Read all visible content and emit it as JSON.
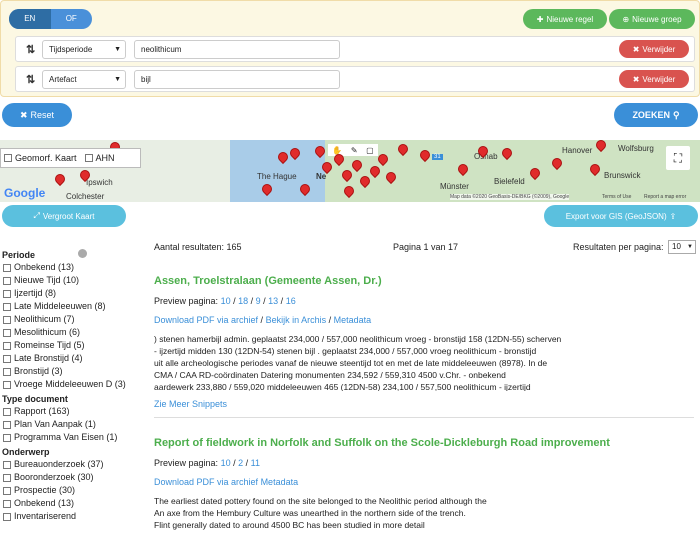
{
  "query": {
    "toggle": {
      "on": "EN",
      "off": "OF"
    },
    "new_rule": "Nieuwe regel",
    "new_group": "Nieuwe groep",
    "rows": [
      {
        "field": "Tijdsperiode",
        "value": "neolithicum",
        "remove": "Verwijder"
      },
      {
        "field": "Artefact",
        "value": "bijl",
        "remove": "Verwijder"
      }
    ],
    "reset": "Reset",
    "search": "ZOEKEN"
  },
  "map": {
    "layer1": "Geomorf. Kaart",
    "layer2": "AHN",
    "labels": [
      "Ipswich",
      "Colchester",
      "The Hague",
      "Ne",
      "Hanover",
      "Wolfsburg",
      "Brunswick",
      "Münster",
      "Bielefeld",
      "Osnab"
    ],
    "google": "Google",
    "attribution": "Map data ©2020 GeoBasis-DE/BKG (©2009), Google",
    "terms": "Terms of Use",
    "report": "Report a map error",
    "badge": "31",
    "enlarge": "Vergroot Kaart",
    "export": "Export voor GIS (GeoJSON)"
  },
  "results": {
    "count_text": "Aantal resultaten: 165",
    "page_text": "Pagina 1 van 17",
    "per_page_label": "Resultaten per pagina:",
    "per_page_value": "10"
  },
  "sidebar": {
    "sections": [
      {
        "title": "Periode",
        "items": [
          "Onbekend (13)",
          "Nieuwe Tijd (10)",
          "Ijzertijd (8)",
          "Late Middeleeuwen (8)",
          "Neolithicum (7)",
          "Mesolithicum (6)",
          "Romeinse Tijd (5)",
          "Late Bronstijd (4)",
          "Bronstijd (3)",
          "Vroege Middeleeuwen D (3)"
        ]
      },
      {
        "title": "Type document",
        "items": [
          "Rapport (163)",
          "Plan Van Aanpak (1)",
          "Programma Van Eisen (1)"
        ]
      },
      {
        "title": "Onderwerp",
        "items": [
          "Bureauonderzoek (37)",
          "Booronderzoek (30)",
          "Prospectie (30)",
          "Onbekend (13)",
          "Inventariserend"
        ]
      }
    ]
  },
  "items": [
    {
      "title": "Assen, Troelstralaan (Gemeente Assen, Dr.)",
      "preview_label": "Preview pagina:",
      "pages": [
        "10",
        "18",
        "9",
        "13",
        "16"
      ],
      "download": "Download PDF via archief",
      "archis": "Bekijk in Archis",
      "metadata": "Metadata",
      "snippet": [
        ") stenen hamerbijl admin. geplaatst 234,000 / 557,000 neolithicum vroeg - bronstijd 158 (12DN-55) scherven",
        "- ijzertijd midden 130 (12DN-54) stenen bijl . geplaatst 234,000 / 557,000 vroeg neolithicum - bronstijd",
        "uit alle archeologische periodes vanaf de nieuwe steentijd tot en met de late middeleeuwen (8978). In de",
        "CMA / CAA RD-coördinaten Datering monumenten 234,592 / 559,310 4500 v.Chr. - onbekend",
        "aardewerk 233,880 / 559,020 middeleeuwen 465 (12DN-58) 234,100 / 557,500 neolithicum - ijzertijd"
      ],
      "more": "Zie Meer Snippets"
    },
    {
      "title": "Report of fieldwork in Norfolk and Suffolk on the Scole-Dickleburgh Road improvement",
      "preview_label": "Preview pagina:",
      "pages": [
        "10",
        "2",
        "11"
      ],
      "download": "Download PDF via archief",
      "metadata": "Metadata",
      "snippet": [
        "The earliest dated pottery found on the site belonged to the Neolithic period although the",
        "An axe from the Hembury Culture was unearthed in the northern side of the trench.",
        "Flint generally dated to around 4500 BC has been studied in more detail"
      ]
    }
  ]
}
